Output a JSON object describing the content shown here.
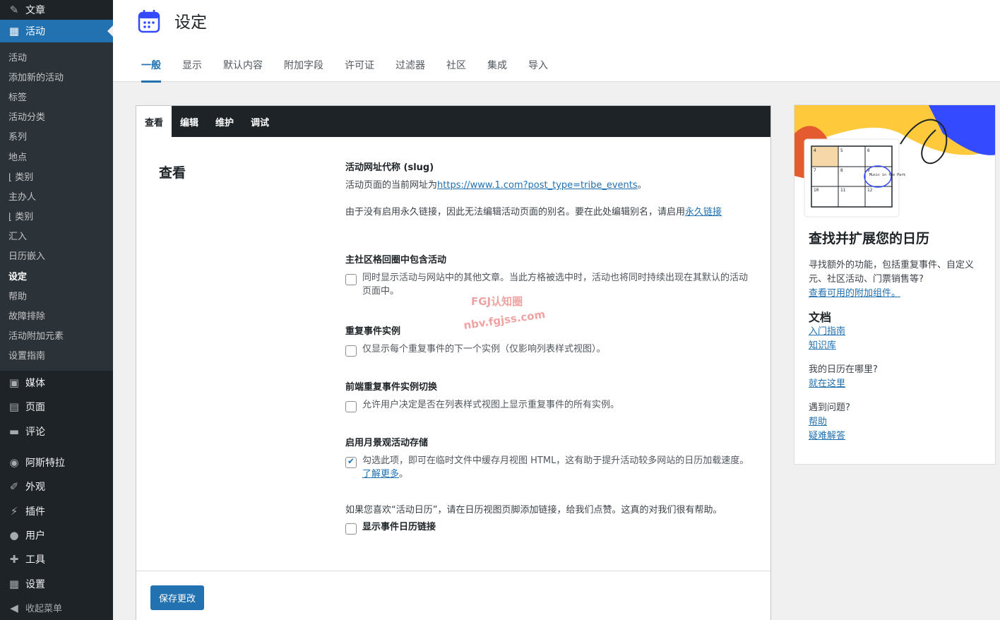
{
  "sidebar": {
    "top_item": "文章",
    "active_item": "活动",
    "submenu": [
      "活动",
      "添加新的活动",
      "标签",
      "活动分类",
      "系列",
      "地点",
      "⌊ 类别",
      "主办人",
      "⌊ 类别",
      "汇入",
      "日历嵌入",
      "设定",
      "帮助",
      "故障排除",
      "活动附加元素",
      "设置指南"
    ],
    "menu": [
      "媒体",
      "页面",
      "评论",
      "阿斯特拉",
      "外观",
      "插件",
      "用户",
      "工具",
      "设置"
    ],
    "collapse": "收起菜单"
  },
  "header": {
    "title": "设定",
    "tabs": [
      "一般",
      "显示",
      "默认内容",
      "附加字段",
      "许可证",
      "过滤器",
      "社区",
      "集成",
      "导入"
    ]
  },
  "panel": {
    "subtabs": [
      "查看",
      "编辑",
      "维护",
      "调试"
    ],
    "section_title": "查看",
    "slug": {
      "label": "活动网址代称 (slug)",
      "desc_prefix": "活动页面的当前网址为",
      "url": "https://www.1.com?post_type=tribe_events",
      "desc_suffix": "。",
      "note_prefix": "由于没有启用永久链接，因此无法编辑活动页面的别名。要在此处编辑别名，请启用",
      "note_link": "永久链接"
    },
    "main_loop": {
      "label": "主社区格回圈中包含活动",
      "text": "同时显示活动与网站中的其他文章。当此方格被选中时，活动也将同时持续出现在其默认的活动页面中。",
      "checked": false
    },
    "recurring": {
      "label": "重复事件实例",
      "text": "仅显示每个重复事件的下一个实例（仅影响列表样式视图）。",
      "checked": false
    },
    "frontend_toggle": {
      "label": "前端重复事件实例切换",
      "text": "允许用户决定是否在列表样式视图上显示重复事件的所有实例。",
      "checked": false
    },
    "month_cache": {
      "label": "启用月景观活动存储",
      "text": "勾选此项，即可在临时文件中缓存月视图 HTML，这有助于提升活动较多网站的日历加载速度。",
      "link": "了解更多",
      "suffix": "。",
      "checked": true
    },
    "credit_note": "如果您喜欢“活动日历”，请在日历视图页脚添加链接，给我们点赞。这真的对我们很有帮助。",
    "show_link": {
      "label": "显示事件日历链接",
      "checked": false
    },
    "save_button": "保存更改"
  },
  "watermark": {
    "line1": "FGJ认知圈",
    "line2": "nbv.fgjss.com"
  },
  "card": {
    "mini_calendar": [
      "4",
      "5",
      "6",
      "7",
      "8",
      "9",
      "10",
      "11",
      "12"
    ],
    "mini_event": "Music in the Park",
    "title": "查找并扩展您的日历",
    "intro": "寻找额外的功能，包括重复事件、自定义元、社区活动、门票销售等?",
    "addons_link": "查看可用的附加组件。",
    "docs_heading": "文档",
    "docs_links": [
      "入门指南",
      "知识库"
    ],
    "where_q": "我的日历在哪里?",
    "where_link": "就在这里",
    "problem_q": "遇到问题?",
    "problem_links": [
      "帮助",
      "疑难解答"
    ]
  }
}
